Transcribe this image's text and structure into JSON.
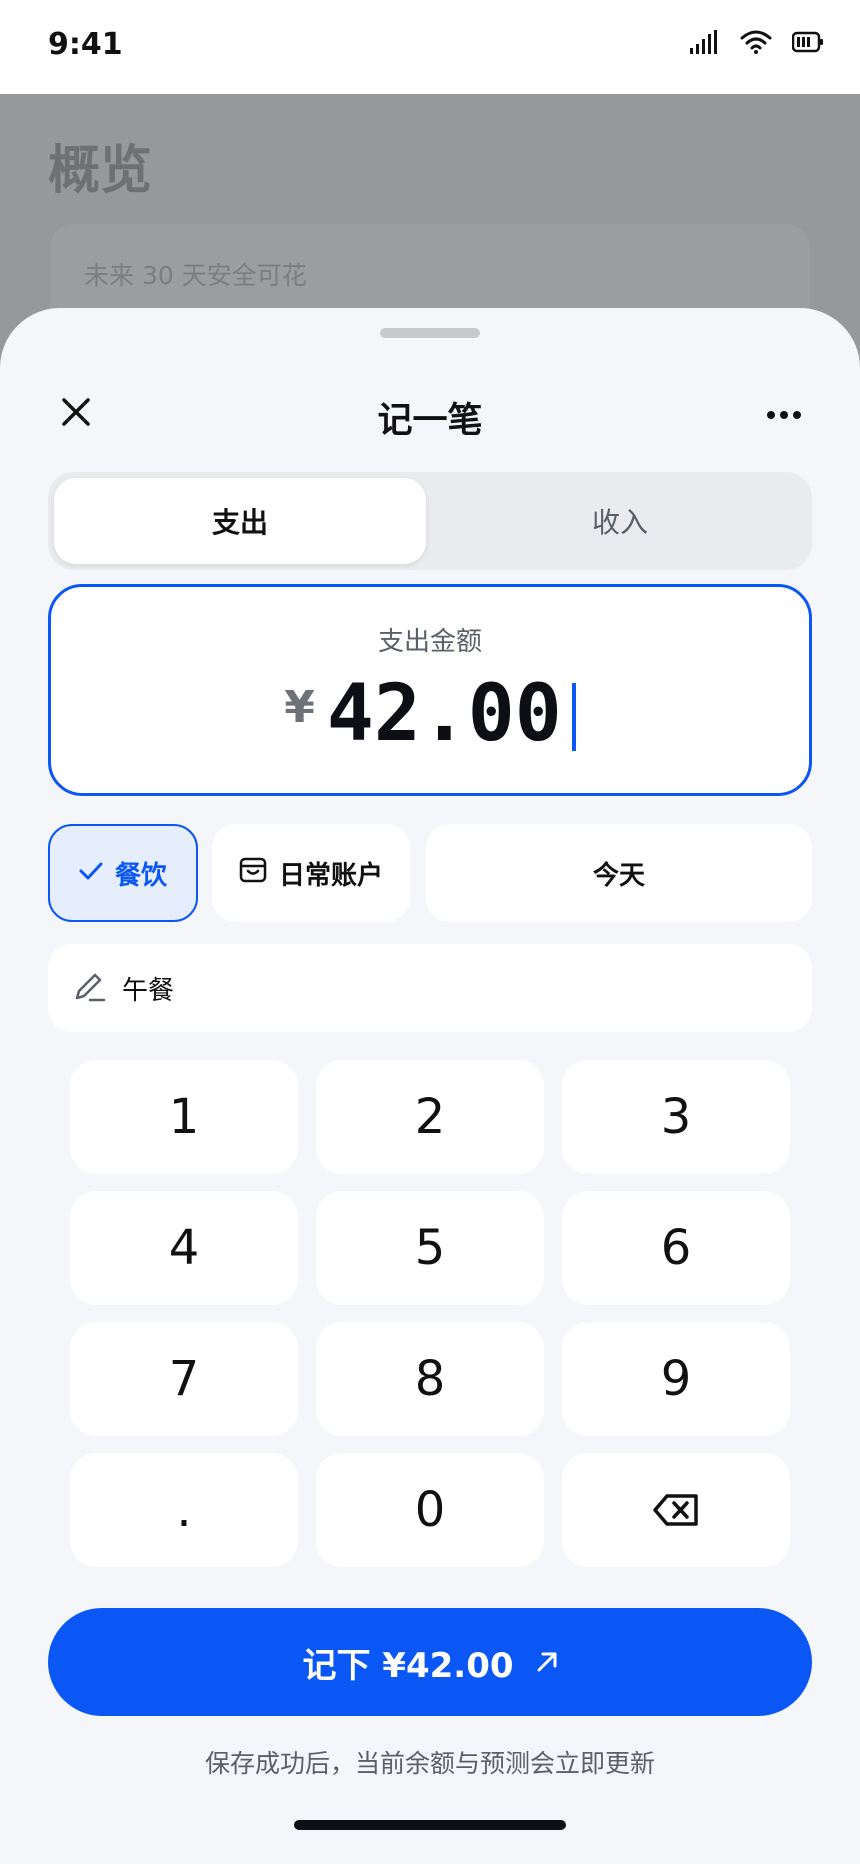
{
  "status_bar": {
    "time": "9:41"
  },
  "background_screen": {
    "title": "概览",
    "card_subtitle": "未来 30 天安全可花"
  },
  "sheet": {
    "title": "记一笔",
    "tabs": [
      {
        "label": "支出",
        "selected": true
      },
      {
        "label": "收入",
        "selected": false
      }
    ],
    "amount": {
      "label": "支出金额",
      "currency": "¥",
      "value": "42.00"
    },
    "chips": {
      "category": "餐饮",
      "account": "日常账户",
      "date": "今天"
    },
    "note": {
      "value": "午餐"
    },
    "keypad": [
      "1",
      "2",
      "3",
      "4",
      "5",
      "6",
      "7",
      "8",
      "9",
      ".",
      "0",
      "backspace"
    ],
    "submit_label": "记下 ¥42.00",
    "hint": "保存成功后，当前余额与预测会立即更新"
  },
  "colors": {
    "accent": "#0a57f5",
    "sheet_bg": "#f4f6f9",
    "backdrop": "#97989b"
  },
  "icons": [
    "signal-icon",
    "wifi-icon",
    "battery-icon",
    "close-icon",
    "more-icon",
    "check-icon",
    "wallet-icon",
    "pencil-icon",
    "backspace-icon",
    "arrow-up-right-icon"
  ]
}
